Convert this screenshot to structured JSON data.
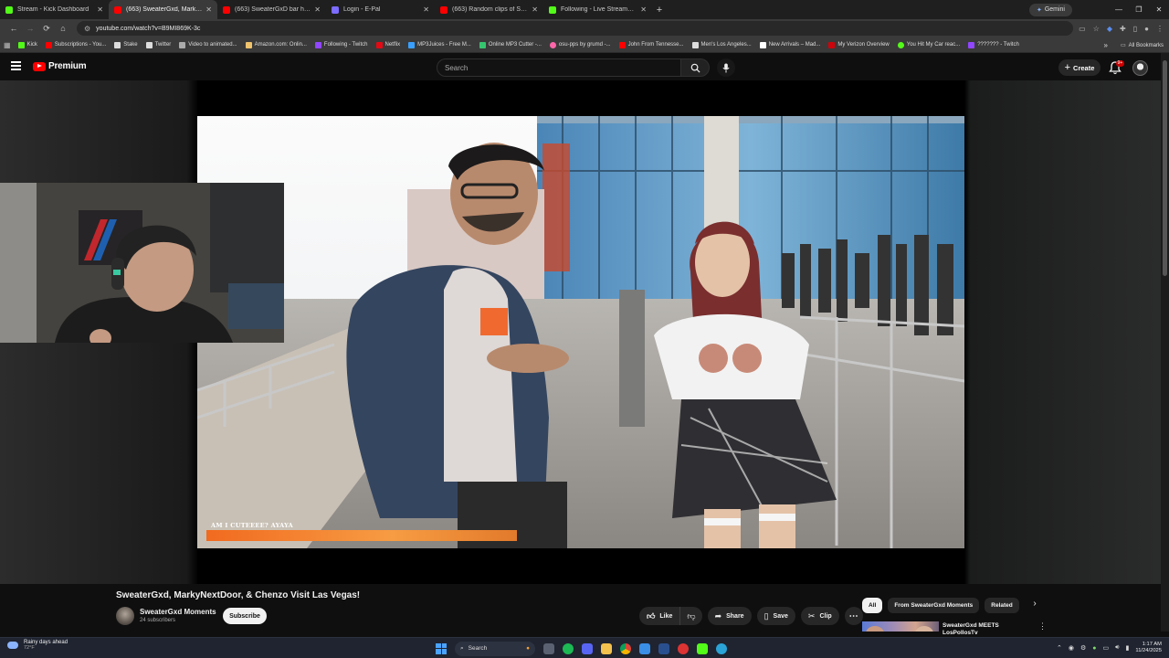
{
  "browser": {
    "tabs": [
      {
        "title": "Stream - Kick Dashboard",
        "favicon_color": "#53fc18",
        "active": false
      },
      {
        "title": "(663) SweaterGxd, MarkyNextDoor",
        "favicon_color": "#ff0000",
        "active": true
      },
      {
        "title": "(663) SweaterGxD bar hopping",
        "favicon_color": "#ff0000",
        "active": false
      },
      {
        "title": "Login - E-Pal",
        "favicon_color": "#7c6cff",
        "active": false
      },
      {
        "title": "(663) Random clips of Sweater",
        "favicon_color": "#ff0000",
        "active": false
      },
      {
        "title": "Following - Live Streams on Kick",
        "favicon_color": "#53fc18",
        "active": false
      }
    ],
    "gemini_label": "Gemini",
    "url": "youtube.com/watch?v=B9MI869K-3c",
    "bookmarks": [
      {
        "label": "Kick",
        "color": "#53fc18"
      },
      {
        "label": "Subscriptions - You...",
        "color": "#ff0000"
      },
      {
        "label": "Stake",
        "color": "#dddddd"
      },
      {
        "label": "Twitter",
        "color": "#dddddd"
      },
      {
        "label": "Video to animated...",
        "color": "#aaaaaa"
      },
      {
        "label": "Amazon.com: Onlin...",
        "color": "#f0c36d"
      },
      {
        "label": "Following - Twitch",
        "color": "#9146ff"
      },
      {
        "label": "Netflix",
        "color": "#e50914"
      },
      {
        "label": "MP3Juices - Free M...",
        "color": "#3aa0ff"
      },
      {
        "label": "Online MP3 Cutter -...",
        "color": "#36c56f"
      },
      {
        "label": "osu-pps by grumd -...",
        "color": "#ff66aa"
      },
      {
        "label": "John From Tennesse...",
        "color": "#ff0000"
      },
      {
        "label": "Men's Los Angeles...",
        "color": "#dddddd"
      },
      {
        "label": "New Arrivals – Mad...",
        "color": "#ffffff"
      },
      {
        "label": "My Verizon Overview",
        "color": "#cd040b"
      },
      {
        "label": "You Hit My Car reac...",
        "color": "#53fc18"
      },
      {
        "label": "??????? - Twitch",
        "color": "#9146ff"
      }
    ],
    "all_bookmarks_label": "All Bookmarks"
  },
  "youtube": {
    "logo_text": "Premium",
    "search_placeholder": "Search",
    "create_label": "Create",
    "notification_count": "9+"
  },
  "video": {
    "caption_text": "AM I CUTEEEE? AYAYA",
    "title": "SweaterGxd, MarkyNextDoor, & Chenzo Visit Las Vegas!",
    "channel_name": "SweaterGxd Moments",
    "subscribers": "24 subscribers",
    "subscribe_label": "Subscribe",
    "actions": {
      "like": "Like",
      "share": "Share",
      "save": "Save",
      "clip": "Clip"
    }
  },
  "recommendations": {
    "chips": [
      "All",
      "From SweaterGxd Moments",
      "Related"
    ],
    "first_title_line1": "SweaterGxd MEETS",
    "first_title_line2": "LosPollosTv"
  },
  "taskbar": {
    "weather_line1": "Rainy days ahead",
    "weather_line2": "72°F",
    "search_label": "Search",
    "time": "1:17 AM",
    "date": "11/24/2025"
  }
}
